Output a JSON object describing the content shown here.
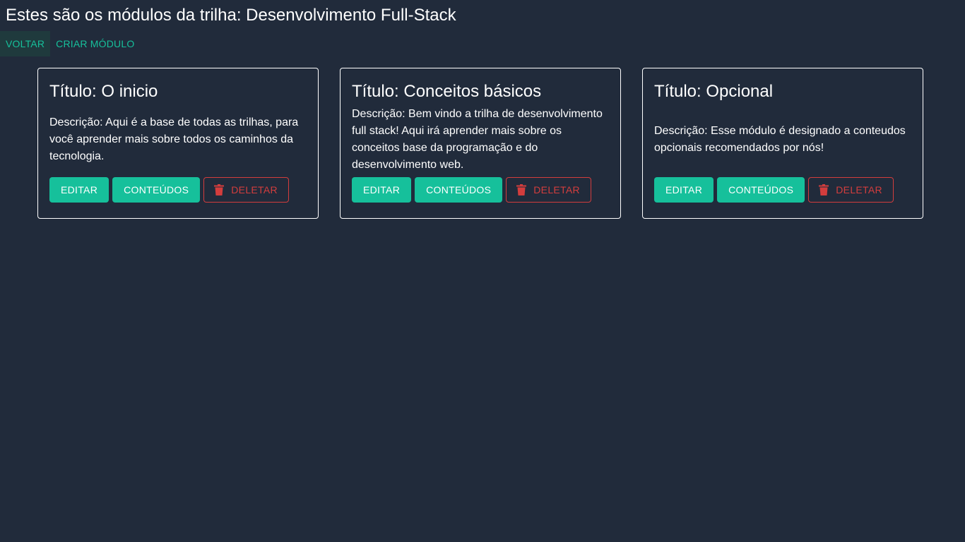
{
  "page": {
    "title": "Estes são os módulos da trilha: Desenvolvimento Full-Stack"
  },
  "toolbar": {
    "back_label": "VOLTAR",
    "create_label": "CRIAR MÓDULO"
  },
  "modules": [
    {
      "title": "Título: O inicio",
      "description": "Descrição: Aqui é a base de todas as trilhas, para você aprender mais sobre todos os caminhos da tecnologia.",
      "edit_label": "EDITAR",
      "contents_label": "CONTEÚDOS",
      "delete_label": "DELETAR"
    },
    {
      "title": "Título: Conceitos básicos",
      "description": "Descrição: Bem vindo a trilha de desenvolvimento full stack! Aqui irá aprender mais sobre os conceitos base da programação e do desenvolvimento web.",
      "edit_label": "EDITAR",
      "contents_label": "CONTEÚDOS",
      "delete_label": "DELETAR"
    },
    {
      "title": "Título: Opcional",
      "description": "Descrição: Esse módulo é designado a conteudos opcionais recomendados por nós!",
      "edit_label": "EDITAR",
      "contents_label": "CONTEÚDOS",
      "delete_label": "DELETAR"
    }
  ],
  "colors": {
    "background": "#212b3b",
    "accent": "#16c09b",
    "danger": "#d33d3d",
    "card_border": "#ffffff"
  },
  "icons": {
    "delete": "trash-icon"
  }
}
